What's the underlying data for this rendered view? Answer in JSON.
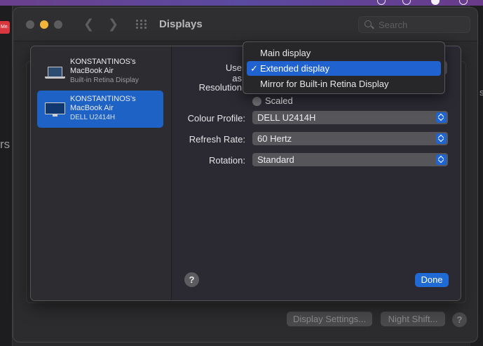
{
  "background": {
    "left_badge": "Me.",
    "left_text": "rs",
    "right_text": "s"
  },
  "window": {
    "title": "Displays",
    "search_placeholder": "Search",
    "bottom_buttons": {
      "display_settings": "Display Settings...",
      "night_shift": "Night Shift...",
      "help": "?"
    }
  },
  "sheet": {
    "displays": [
      {
        "name": "KONSTANTINOS's MacBook Air",
        "subtitle": "Built-in Retina Display",
        "icon": "laptop-icon",
        "selected": false
      },
      {
        "name": "KONSTANTINOS's MacBook Air",
        "subtitle": "DELL U2414H",
        "icon": "monitor-icon",
        "selected": true
      }
    ],
    "labels": {
      "use_as": "Use as",
      "resolution": "Resolution",
      "colour_profile": "Colour Profile:",
      "refresh_rate": "Refresh Rate:",
      "rotation": "Rotation:"
    },
    "resolution_option": "Scaled",
    "colour_profile": "DELL U2414H",
    "refresh_rate": "60 Hertz",
    "rotation": "Standard",
    "help": "?",
    "done": "Done"
  },
  "use_as_menu": {
    "items": [
      {
        "label": "Main display",
        "checked": false
      },
      {
        "label": "Extended display",
        "checked": true
      },
      {
        "label": "Mirror for Built-in Retina Display",
        "checked": false
      }
    ],
    "check_glyph": "✓"
  },
  "colors": {
    "accent": "#1f62d0",
    "traffic_minimize": "#f4b43a"
  }
}
